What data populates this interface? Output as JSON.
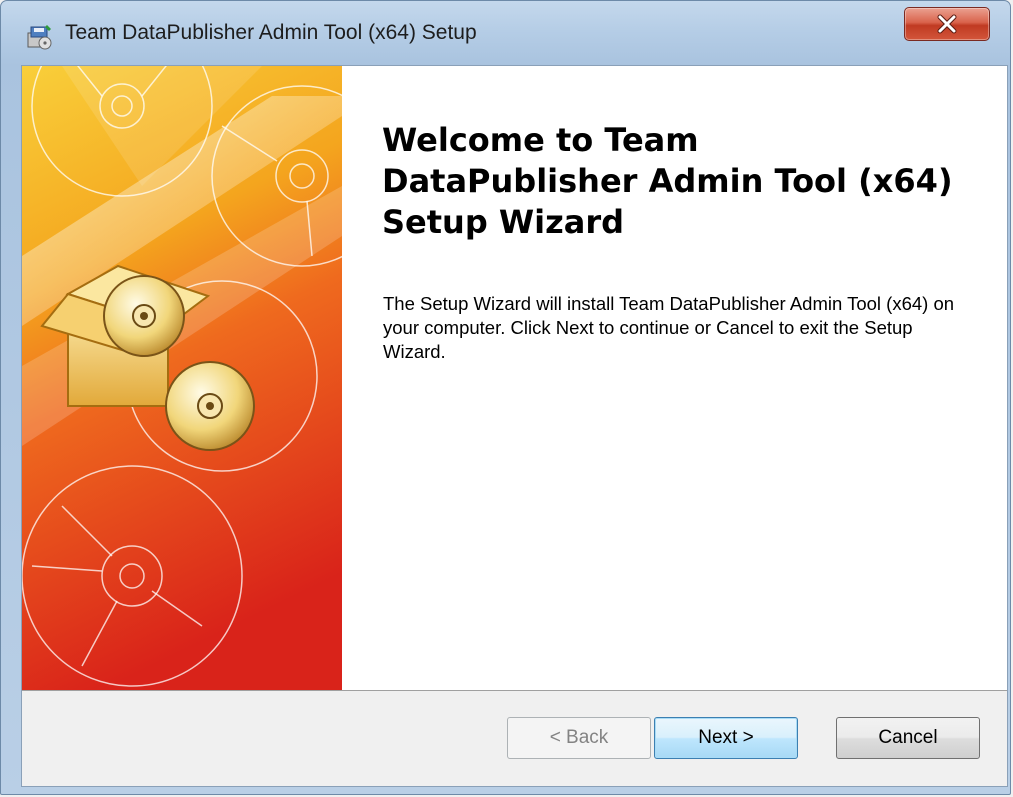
{
  "window": {
    "title": "Team DataPublisher Admin Tool (x64) Setup",
    "close_glyph": "x"
  },
  "wizard": {
    "heading": "Welcome to Team DataPublisher Admin Tool (x64) Setup Wizard",
    "body": "The Setup Wizard will install Team DataPublisher Admin Tool (x64) on your computer.  Click Next to continue or Cancel to exit the Setup Wizard."
  },
  "buttons": {
    "back": "< Back",
    "next": "Next >",
    "cancel": "Cancel"
  },
  "icons": {
    "title": "installer-package-icon",
    "close": "close-icon"
  },
  "colors": {
    "banner_top": "#f7c21a",
    "banner_bottom": "#d9231a",
    "default_button": "#3c7fb1",
    "close_button": "#c9472f"
  }
}
